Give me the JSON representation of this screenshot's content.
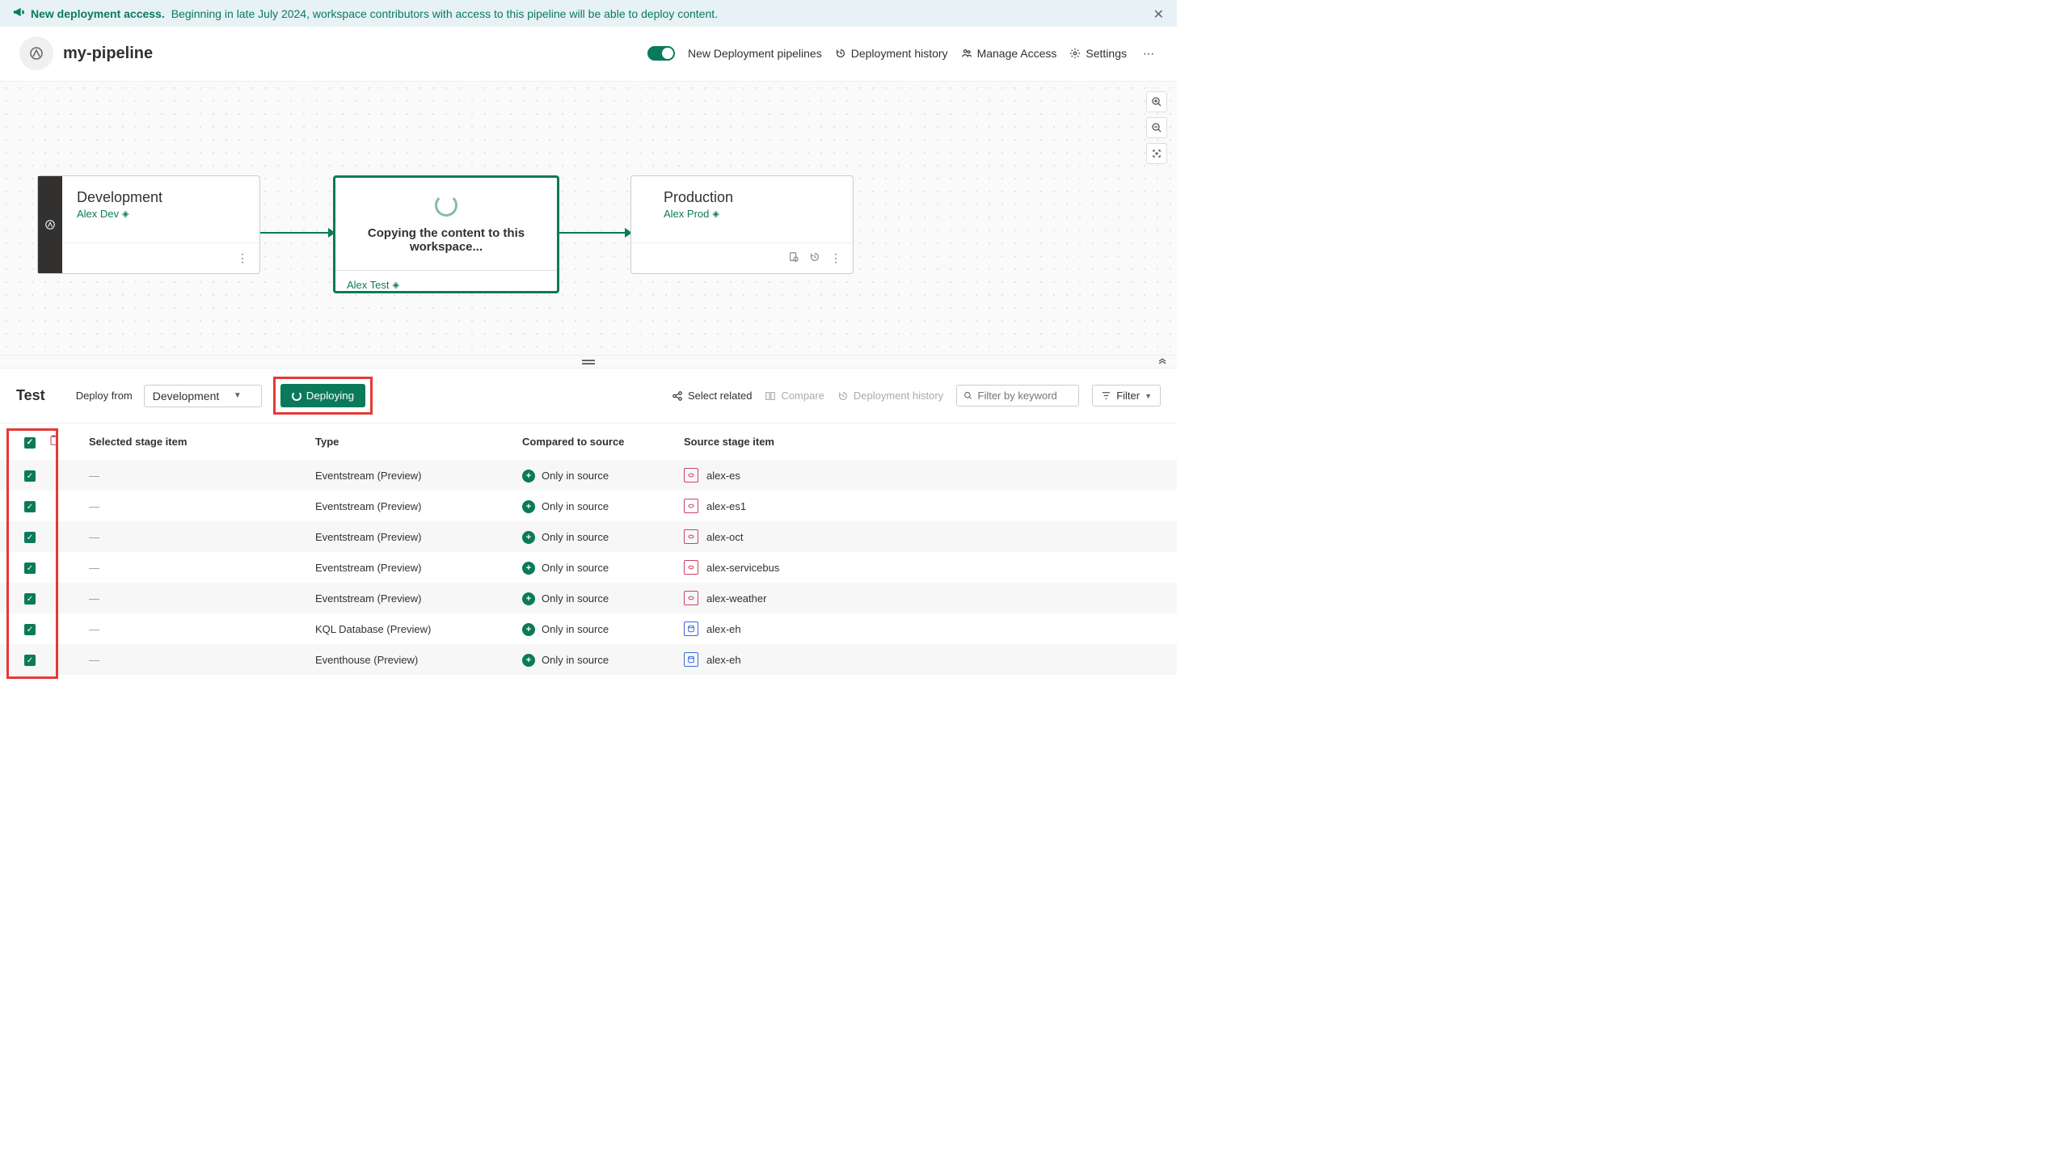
{
  "banner": {
    "title": "New deployment access.",
    "text": "Beginning in late July 2024, workspace contributors with access to this pipeline will be able to deploy content."
  },
  "header": {
    "title": "my-pipeline",
    "toggle_label": "New Deployment pipelines",
    "history": "Deployment history",
    "access": "Manage Access",
    "settings": "Settings"
  },
  "stages": {
    "dev": {
      "name": "Development",
      "workspace": "Alex Dev"
    },
    "test": {
      "message": "Copying the content to this workspace...",
      "workspace": "Alex Test"
    },
    "prod": {
      "name": "Production",
      "workspace": "Alex Prod"
    }
  },
  "panel": {
    "title": "Test",
    "deploy_from_label": "Deploy from",
    "deploy_from_value": "Development",
    "deploy_btn": "Deploying",
    "select_related": "Select related",
    "compare": "Compare",
    "history": "Deployment history",
    "filter_placeholder": "Filter by keyword",
    "filter_btn": "Filter"
  },
  "table": {
    "headers": {
      "sel": "Selected stage item",
      "type": "Type",
      "cmp": "Compared to source",
      "src": "Source stage item"
    },
    "rows": [
      {
        "type": "Eventstream (Preview)",
        "cmp": "Only in source",
        "src": "alex-es",
        "icon": "es"
      },
      {
        "type": "Eventstream (Preview)",
        "cmp": "Only in source",
        "src": "alex-es1",
        "icon": "es"
      },
      {
        "type": "Eventstream (Preview)",
        "cmp": "Only in source",
        "src": "alex-oct",
        "icon": "es"
      },
      {
        "type": "Eventstream (Preview)",
        "cmp": "Only in source",
        "src": "alex-servicebus",
        "icon": "es"
      },
      {
        "type": "Eventstream (Preview)",
        "cmp": "Only in source",
        "src": "alex-weather",
        "icon": "es"
      },
      {
        "type": "KQL Database (Preview)",
        "cmp": "Only in source",
        "src": "alex-eh",
        "icon": "db"
      },
      {
        "type": "Eventhouse (Preview)",
        "cmp": "Only in source",
        "src": "alex-eh",
        "icon": "db"
      }
    ]
  }
}
